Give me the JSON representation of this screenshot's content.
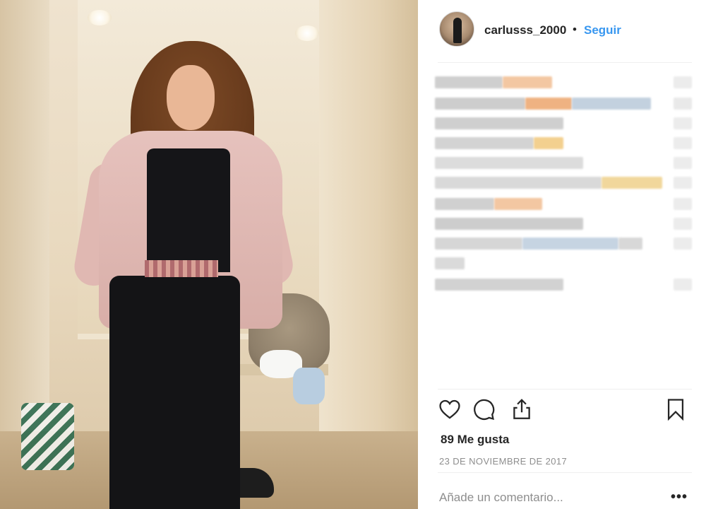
{
  "post": {
    "username": "carlusss_2000",
    "separator": "•",
    "follow_label": "Seguir",
    "likes_text": "89 Me gusta",
    "date_text": "23 DE NOVIEMBRE DE 2017",
    "comment_placeholder": "Añade un comentario...",
    "more_label": "•••"
  },
  "icons": {
    "like": "heart-icon",
    "comment": "comment-bubble-icon",
    "share": "share-icon",
    "save": "bookmark-icon"
  },
  "colors": {
    "link_blue": "#3897f0",
    "text": "#262626",
    "muted": "#8e8e8e",
    "divider": "#efefef"
  }
}
